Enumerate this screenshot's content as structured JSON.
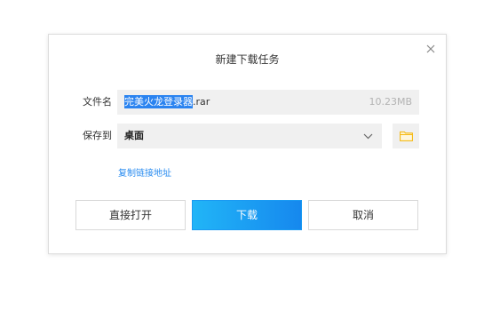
{
  "dialog": {
    "title": "新建下载任务",
    "close_icon": "close-icon"
  },
  "filename": {
    "label": "文件名",
    "selected_part": "完美火龙登录器",
    "extension": ".rar",
    "size": "10.23MB"
  },
  "save": {
    "label": "保存到",
    "value": "桌面",
    "dropdown_icon": "chevron-down-icon",
    "browse_icon": "folder-icon"
  },
  "copy_link": "复制链接地址",
  "buttons": {
    "open": "直接打开",
    "download": "下载",
    "cancel": "取消"
  },
  "colors": {
    "accent": "#1a9af2",
    "link": "#2a8cf0",
    "selection": "#2a83f0",
    "folder": "#f5b400"
  }
}
